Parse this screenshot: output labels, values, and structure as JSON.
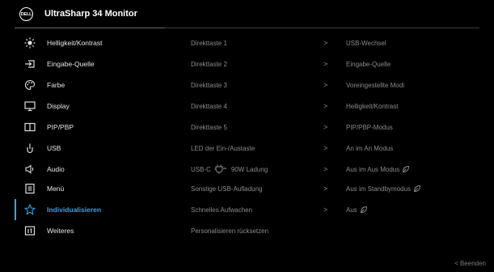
{
  "header": {
    "logo": "DELL",
    "title": "UltraSharp 34 Monitor"
  },
  "sidebar": {
    "items": [
      {
        "label": "Helligkeit/Kontrast",
        "icon": "brightness-icon"
      },
      {
        "label": "Eingabe-Quelle",
        "icon": "input-source-icon"
      },
      {
        "label": "Farbe",
        "icon": "color-palette-icon"
      },
      {
        "label": "Display",
        "icon": "display-icon"
      },
      {
        "label": "PIP/PBP",
        "icon": "pip-pbp-icon"
      },
      {
        "label": "USB",
        "icon": "usb-icon"
      },
      {
        "label": "Audio",
        "icon": "speaker-icon"
      },
      {
        "label": "Menü",
        "icon": "menu-icon"
      },
      {
        "label": "Individualisieren",
        "icon": "star-icon",
        "active": true
      },
      {
        "label": "Weiteres",
        "icon": "info-icon"
      }
    ]
  },
  "settings": {
    "rows": [
      {
        "name": "Direkttaste 1",
        "arrow": ">",
        "value": "USB-Wechsel"
      },
      {
        "name": "Direkttaste 2",
        "arrow": ">",
        "value": "Eingabe-Quelle"
      },
      {
        "name": "Direkttaste 3",
        "arrow": ">",
        "value": "Voreingestellte Modi"
      },
      {
        "name": "Direkttaste 4",
        "arrow": ">",
        "value": "Helligkeit/Kontrast"
      },
      {
        "name": "Direkttaste 5",
        "arrow": ">",
        "value": "PIP/PBP-Modus"
      },
      {
        "name": "LED der Ein-/Austaste",
        "arrow": ">",
        "value": "An im An Modus"
      },
      {
        "name_prefix": "USB-C",
        "name_suffix": "90W Ladung",
        "arrow": ">",
        "value": "Aus im Aus Modus",
        "leaf": true
      },
      {
        "name": "Sonstige USB-Aufladung",
        "arrow": ">",
        "value": "Aus im Standbymodus",
        "leaf": true
      },
      {
        "name": "Schnelles Aufwachen",
        "arrow": ">",
        "value": "Aus",
        "leaf": true
      },
      {
        "name": "Personalisieren rücksetzen"
      }
    ]
  },
  "footer": {
    "exit_label": "< Beenden"
  },
  "colors": {
    "accent": "#3aa2e8",
    "background": "#000000"
  }
}
